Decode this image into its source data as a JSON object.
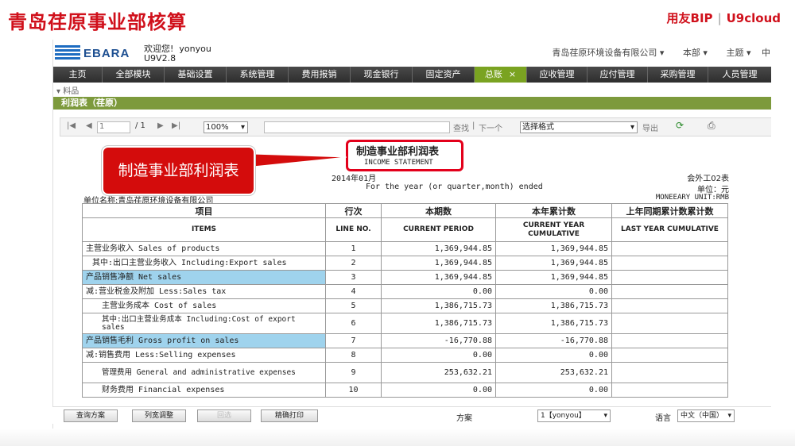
{
  "slide": {
    "title": "青岛荏原事业部核算",
    "brand_left": "用友BIP",
    "brand_sep": "|",
    "brand_right": "U9cloud"
  },
  "app": {
    "logo_text": "EBARA",
    "welcome": "欢迎您!",
    "user": "yonyou",
    "version": "U9V2.8",
    "org": "青岛荏原环境设备有限公司",
    "top_links": [
      "本部",
      "主题",
      "中"
    ]
  },
  "menu": {
    "items": [
      "主页",
      "全部模块",
      "基础设置",
      "系统管理",
      "费用报销",
      "现金银行",
      "固定资产",
      "总账",
      "应收管理",
      "应付管理",
      "采购管理",
      "人员管理"
    ],
    "active_index": 7,
    "close_glyph": "×"
  },
  "breadcrumb": "料品",
  "panel_title": "利润表（荏原）",
  "toolbar": {
    "page_value": "1",
    "page_total": "/ 1",
    "zoom": "100%",
    "find_label": "查找",
    "next_label": "下一个",
    "format_select": "选择格式",
    "export_label": "导出"
  },
  "report": {
    "title": "制造事业部利润表",
    "subtitle": "INCOME STATEMENT",
    "date": "2014年01月",
    "form_no": "会外工02表",
    "for_line": "For the year (or quarter,month) ended",
    "unit": "单位：元",
    "company": "单位名称:青岛荏原环境设备有限公司",
    "money_unit": "MONEEARY UNIT:RMB",
    "headers_cn": [
      "项目",
      "行次",
      "本期数",
      "本年累计数",
      "上年同期累计数累计数"
    ],
    "headers_en": [
      "ITEMS",
      "LINE NO.",
      "CURRENT PERIOD",
      "CURRENT YEAR CUMULATIVE",
      "LAST YEAR CUMULATIVE"
    ],
    "rows": [
      {
        "item": "主营业务收入 Sales of products",
        "line": "1",
        "current": "1,369,944.85",
        "cumulative": "1,369,944.85",
        "last": ""
      },
      {
        "item": "其中:出口主营业务收入 Including:Export sales",
        "line": "2",
        "current": "1,369,944.85",
        "cumulative": "1,369,944.85",
        "last": ""
      },
      {
        "item": "产品销售净额 Net sales",
        "line": "3",
        "current": "1,369,944.85",
        "cumulative": "1,369,944.85",
        "last": ""
      },
      {
        "item": "减:营业税金及附加 Less:Sales tax",
        "line": "4",
        "current": "0.00",
        "cumulative": "0.00",
        "last": ""
      },
      {
        "item": "主营业务成本 Cost of sales",
        "line": "5",
        "current": "1,386,715.73",
        "cumulative": "1,386,715.73",
        "last": ""
      },
      {
        "item": "其中:出口主营业务成本 Including:Cost of export sales",
        "line": "6",
        "current": "1,386,715.73",
        "cumulative": "1,386,715.73",
        "last": ""
      },
      {
        "item": "产品销售毛利 Gross profit on sales",
        "line": "7",
        "current": "-16,770.88",
        "cumulative": "-16,770.88",
        "last": ""
      },
      {
        "item": "减:销售费用 Less:Selling expenses",
        "line": "8",
        "current": "0.00",
        "cumulative": "0.00",
        "last": ""
      },
      {
        "item": "管理费用 General and administrative expenses",
        "line": "9",
        "current": "253,632.21",
        "cumulative": "253,632.21",
        "last": ""
      },
      {
        "item": "财务费用 Financial expenses",
        "line": "10",
        "current": "0.00",
        "cumulative": "0.00",
        "last": ""
      }
    ]
  },
  "callout": "制造事业部利润表",
  "bottom": {
    "buttons": [
      "查询方案",
      "列宽调整",
      "回选",
      "精确打印"
    ],
    "scheme_label": "方案",
    "scheme_value": "1【yonyou】",
    "lang_label": "语言",
    "lang_value": "中文（中国）"
  },
  "colors": {
    "brand_red": "#d0101b",
    "menu_active": "#7aa321",
    "panel_green": "#7d9a3c",
    "highlight_blue": "#9fd3ed"
  }
}
